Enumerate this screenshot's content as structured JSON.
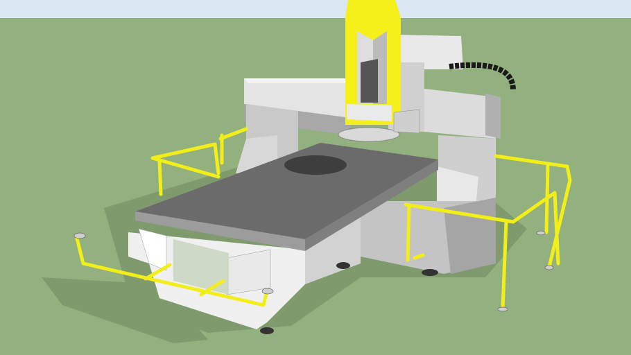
{
  "scene": {
    "colors": {
      "sky": "#dbe7f2",
      "ground": "#93b07f",
      "shadow": "#6f8a60",
      "machine_light": "#ececec",
      "machine_mid": "#cfcfcf",
      "machine_dark": "#9a9a9a",
      "table_top": "#6b6b6b",
      "table_edge": "#9c9c9c",
      "safety_rail": "#f2ee1a",
      "spindle_yellow": "#f5f019",
      "cable_chain": "#1a1a1a"
    },
    "icons": [
      "cnc-router-model"
    ]
  }
}
